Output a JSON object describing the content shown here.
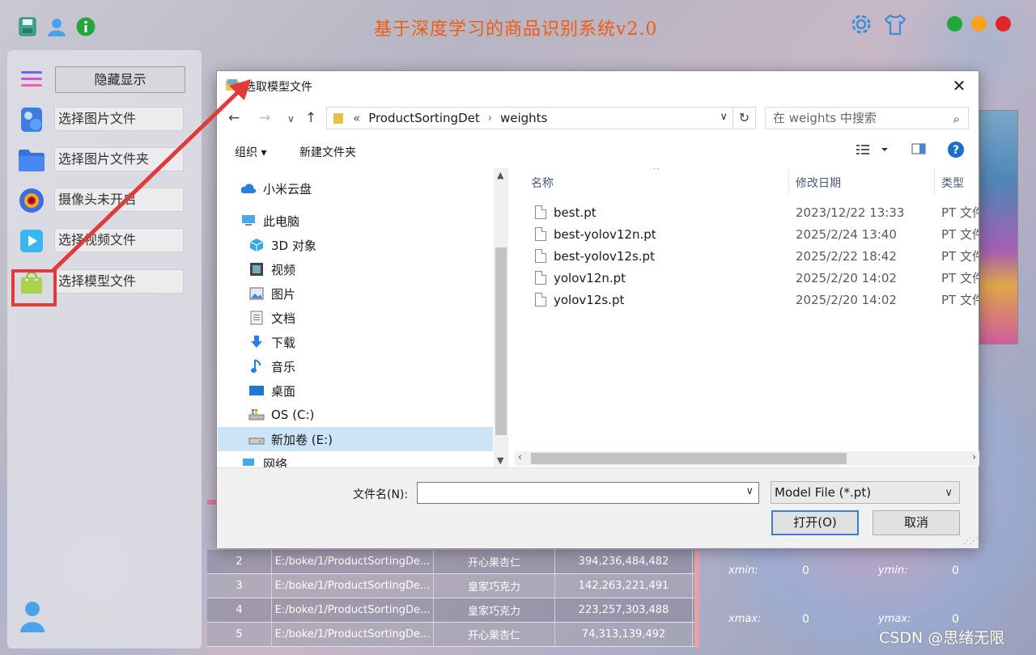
{
  "app": {
    "title": "基于深度学习的商品识别系统v2.0",
    "colors": {
      "title": "#e06228",
      "close_dot": "#e0262b",
      "min_dot": "#f6a21b",
      "max_dot": "#1fa83a"
    }
  },
  "sidebar": {
    "hide_button": "隐藏显示",
    "items": [
      {
        "label": "选择图片文件",
        "icon": "image-file-icon"
      },
      {
        "label": "选择图片文件夹",
        "icon": "folder-icon"
      },
      {
        "label": "摄像头未开启",
        "icon": "camera-icon"
      },
      {
        "label": "选择视频文件",
        "icon": "video-play-icon"
      },
      {
        "label": "选择模型文件",
        "icon": "model-bag-icon"
      }
    ]
  },
  "background_table": {
    "rows": [
      {
        "idx": "2",
        "path": "E:/boke/1/ProductSortingDe...",
        "cls": "开心果杏仁",
        "box": "394,236,484,482"
      },
      {
        "idx": "3",
        "path": "E:/boke/1/ProductSortingDe...",
        "cls": "皇家巧克力",
        "box": "142,263,221,491"
      },
      {
        "idx": "4",
        "path": "E:/boke/1/ProductSortingDe...",
        "cls": "皇家巧克力",
        "box": "223,257,303,488"
      },
      {
        "idx": "5",
        "path": "E:/boke/1/ProductSortingDe...",
        "cls": "开心果杏仁",
        "box": "74,313,139,492"
      }
    ],
    "coords": {
      "xmin_label": "xmin:",
      "xmin_value": "0",
      "ymin_label": "ymin:",
      "ymin_value": "0",
      "xmax_label": "xmax:",
      "xmax_value": "0",
      "ymax_label": "ymax:",
      "ymax_value": "0"
    }
  },
  "watermark": "CSDN @思绪无限",
  "dialog": {
    "title": "选取模型文件",
    "address": {
      "root_symbol": "«",
      "path": [
        "ProductSortingDet",
        "weights"
      ]
    },
    "search_placeholder": "在 weights 中搜索",
    "toolbar": {
      "organize": "组织 ▾",
      "new_folder": "新建文件夹"
    },
    "nav_items": [
      {
        "label": "小米云盘",
        "icon": "cloud-icon"
      },
      {
        "label": "此电脑",
        "icon": "this-pc-icon"
      },
      {
        "label": "3D 对象",
        "icon": "3d-objects-icon"
      },
      {
        "label": "视频",
        "icon": "videos-icon"
      },
      {
        "label": "图片",
        "icon": "pictures-icon"
      },
      {
        "label": "文档",
        "icon": "documents-icon"
      },
      {
        "label": "下载",
        "icon": "downloads-icon"
      },
      {
        "label": "音乐",
        "icon": "music-icon"
      },
      {
        "label": "桌面",
        "icon": "desktop-icon"
      },
      {
        "label": "OS (C:)",
        "icon": "drive-c-icon"
      },
      {
        "label": "新加卷 (E:)",
        "icon": "drive-e-icon"
      },
      {
        "label": "网络",
        "icon": "network-icon"
      }
    ],
    "columns": {
      "name": "名称",
      "date": "修改日期",
      "type": "类型"
    },
    "files": [
      {
        "name": "best.pt",
        "date": "2023/12/22 13:33",
        "type": "PT 文件"
      },
      {
        "name": "best-yolov12n.pt",
        "date": "2025/2/24 13:40",
        "type": "PT 文件"
      },
      {
        "name": "best-yolov12s.pt",
        "date": "2025/2/22 18:42",
        "type": "PT 文件"
      },
      {
        "name": "yolov12n.pt",
        "date": "2025/2/20 14:02",
        "type": "PT 文件"
      },
      {
        "name": "yolov12s.pt",
        "date": "2025/2/20 14:02",
        "type": "PT 文件"
      }
    ],
    "filename_label": "文件名(N):",
    "filename_value": "",
    "filter": "Model File (*.pt)",
    "open_button": "打开(O)",
    "cancel_button": "取消"
  }
}
